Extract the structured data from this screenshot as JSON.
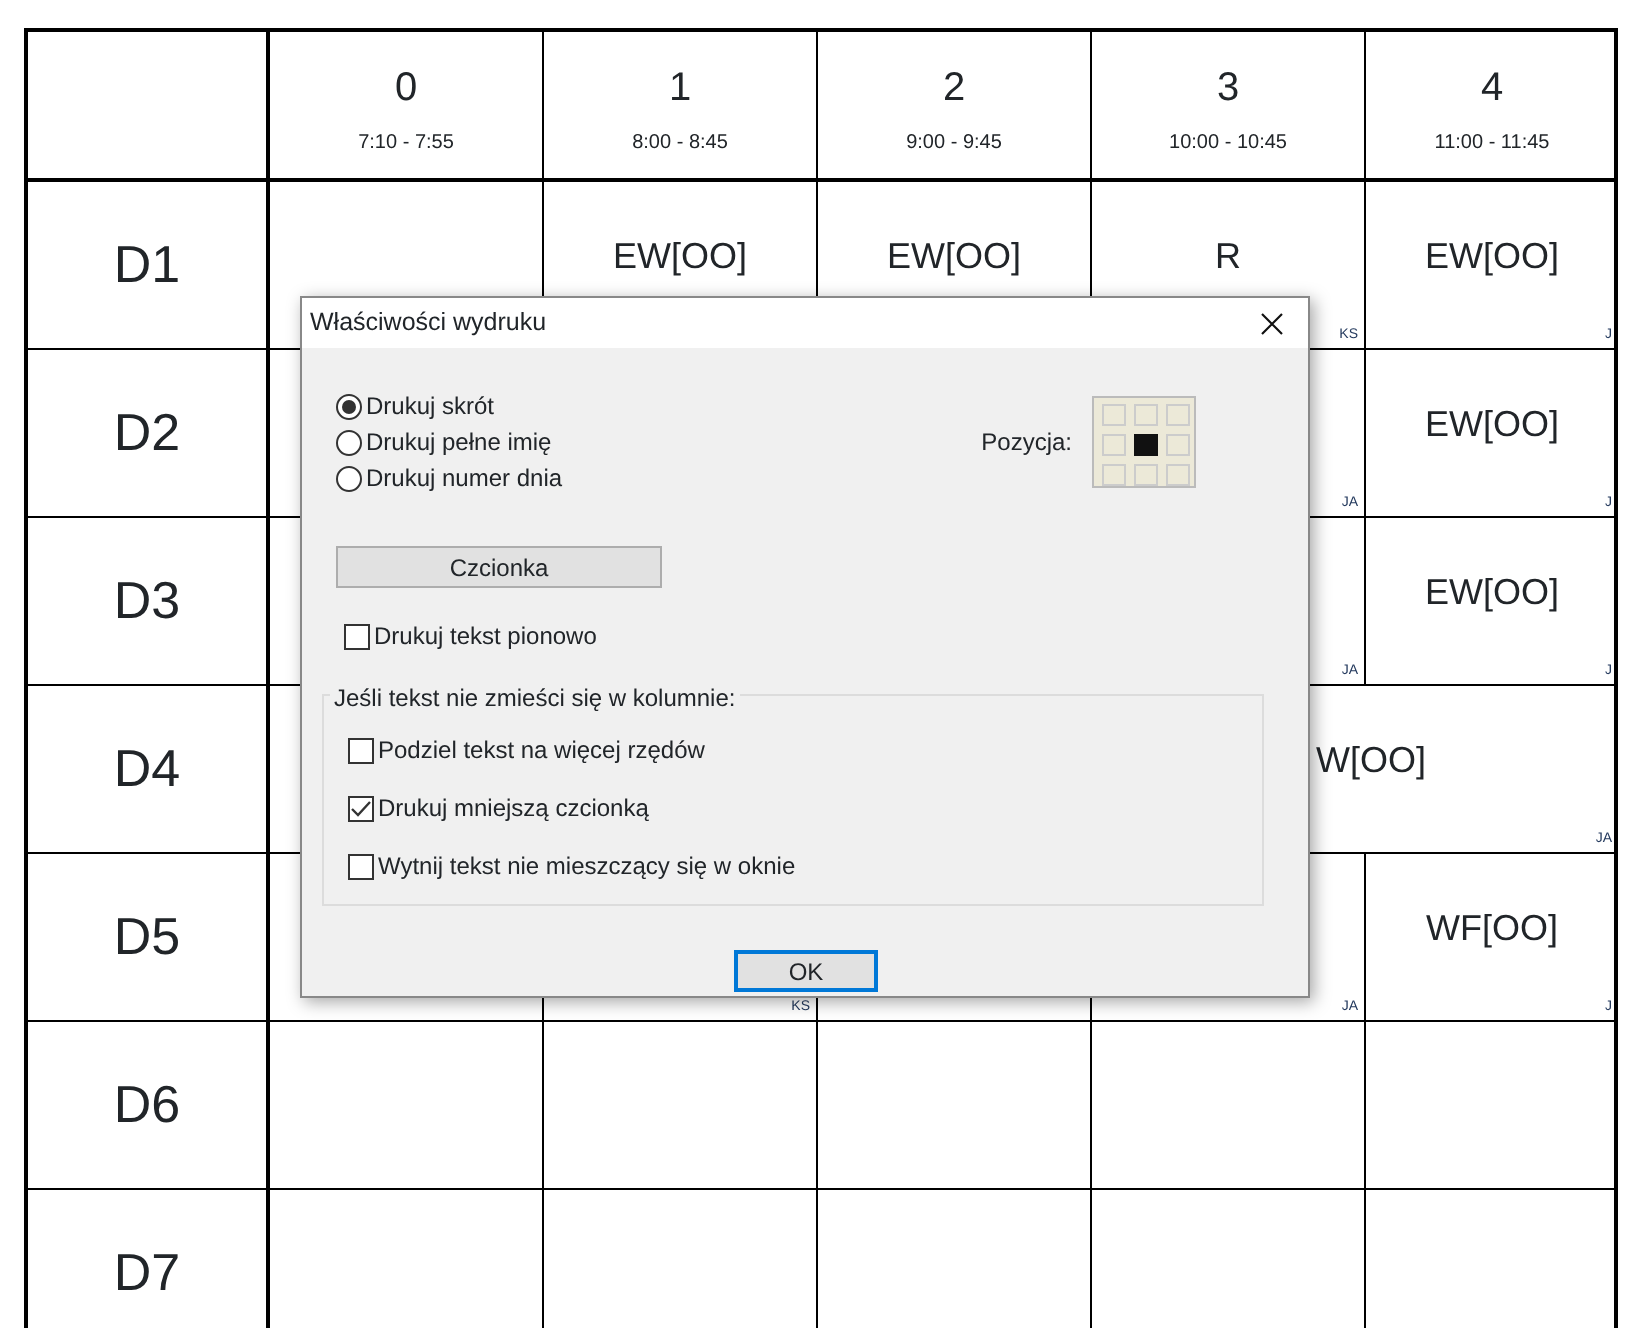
{
  "timetable": {
    "columns": [
      {
        "number": "0",
        "time": "7:10 - 7:55"
      },
      {
        "number": "1",
        "time": "8:00 - 8:45"
      },
      {
        "number": "2",
        "time": "9:00 - 9:45"
      },
      {
        "number": "3",
        "time": "10:00 - 10:45"
      },
      {
        "number": "4",
        "time": "11:00 - 11:45"
      }
    ],
    "rows": [
      {
        "label": "D1",
        "cells": [
          {},
          {
            "subject": "EW[OO]"
          },
          {
            "subject": "EW[OO]"
          },
          {
            "subject": "R",
            "teacher": "KS"
          },
          {
            "subject": "EW[OO]",
            "teacher": "J"
          }
        ]
      },
      {
        "label": "D2",
        "cells": [
          {},
          {},
          {},
          {
            "teacher": "JA"
          },
          {
            "subject": "EW[OO]",
            "teacher": "J"
          }
        ]
      },
      {
        "label": "D3",
        "cells": [
          {},
          {},
          {},
          {
            "teacher": "JA"
          },
          {
            "subject": "EW[OO]",
            "teacher": "J"
          }
        ]
      },
      {
        "label": "D4",
        "cells": [
          {},
          {},
          {},
          {
            "subject": "W[OO]",
            "teacher": "JA",
            "wide": true
          }
        ]
      },
      {
        "label": "D5",
        "cells": [
          {},
          {
            "teacher": "KS"
          },
          {},
          {
            "teacher": "JA"
          },
          {
            "subject": "WF[OO]",
            "teacher": "J"
          }
        ]
      },
      {
        "label": "D6",
        "cells": [
          {},
          {},
          {},
          {},
          {}
        ]
      },
      {
        "label": "D7",
        "cells": [
          {},
          {},
          {},
          {},
          {}
        ]
      }
    ]
  },
  "dialog": {
    "title": "Właściwości wydruku",
    "radios": [
      {
        "label": "Drukuj skrót",
        "selected": true
      },
      {
        "label": "Drukuj pełne imię",
        "selected": false
      },
      {
        "label": "Drukuj numer dnia",
        "selected": false
      }
    ],
    "position_label": "Pozycja:",
    "position_grid": [
      {
        "selected": false
      },
      {
        "selected": false
      },
      {
        "selected": false
      },
      {
        "selected": false
      },
      {
        "selected": true
      },
      {
        "selected": false
      },
      {
        "selected": false
      },
      {
        "selected": false
      },
      {
        "selected": false
      }
    ],
    "font_button": "Czcionka",
    "vertical": {
      "label": "Drukuj tekst pionowo",
      "checked": false
    },
    "overflow_group": {
      "title": "Jeśli tekst nie zmieści się w kolumnie:",
      "options": [
        {
          "label": "Podziel tekst na więcej rzędów",
          "checked": false
        },
        {
          "label": "Drukuj mniejszą czcionką",
          "checked": true
        },
        {
          "label": "Wytnij tekst nie mieszczący się w oknie",
          "checked": false
        }
      ]
    },
    "ok_button": "OK"
  }
}
